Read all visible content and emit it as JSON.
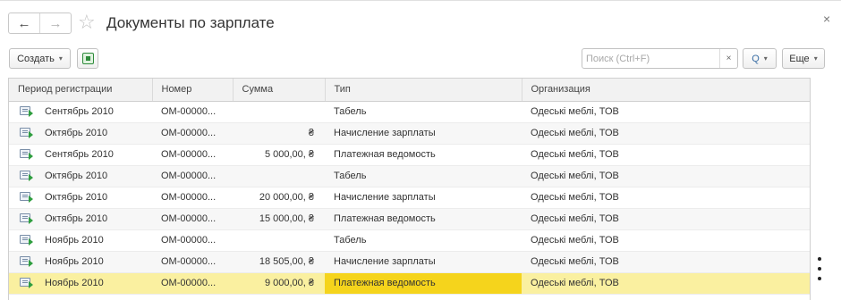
{
  "header": {
    "back_icon": "←",
    "forward_icon": "→",
    "star_icon": "☆",
    "title": "Документы по зарплате",
    "close_icon": "×"
  },
  "toolbar": {
    "create_label": "Создать",
    "caret": "▾",
    "search_placeholder": "Поиск (Ctrl+F)",
    "search_value": "",
    "clear_icon": "×",
    "search_icon": "Q",
    "more_label": "Еще"
  },
  "table": {
    "columns": [
      "Период регистрации",
      "Номер",
      "Сумма",
      "Тип",
      "Организация"
    ],
    "rows": [
      {
        "period": "Сентябрь 2010",
        "number": "ОМ-00000...",
        "sum": "",
        "type": "Табель",
        "org": "Одеські меблі, ТОВ"
      },
      {
        "period": "Октябрь 2010",
        "number": "ОМ-00000...",
        "sum": "₴",
        "type": "Начисление зарплаты",
        "org": "Одеські меблі, ТОВ"
      },
      {
        "period": "Сентябрь 2010",
        "number": "ОМ-00000...",
        "sum": "5 000,00, ₴",
        "type": "Платежная ведомость",
        "org": "Одеські меблі, ТОВ"
      },
      {
        "period": "Октябрь 2010",
        "number": "ОМ-00000...",
        "sum": "",
        "type": "Табель",
        "org": "Одеські меблі, ТОВ"
      },
      {
        "period": "Октябрь 2010",
        "number": "ОМ-00000...",
        "sum": "20 000,00, ₴",
        "type": "Начисление зарплаты",
        "org": "Одеські меблі, ТОВ"
      },
      {
        "period": "Октябрь 2010",
        "number": "ОМ-00000...",
        "sum": "15 000,00, ₴",
        "type": "Платежная ведомость",
        "org": "Одеські меблі, ТОВ"
      },
      {
        "period": "Ноябрь 2010",
        "number": "ОМ-00000...",
        "sum": "",
        "type": "Табель",
        "org": "Одеські меблі, ТОВ"
      },
      {
        "period": "Ноябрь 2010",
        "number": "ОМ-00000...",
        "sum": "18 505,00, ₴",
        "type": "Начисление зарплаты",
        "org": "Одеські меблі, ТОВ"
      },
      {
        "period": "Ноябрь 2010",
        "number": "ОМ-00000...",
        "sum": "9 000,00, ₴",
        "type": "Платежная ведомость",
        "org": "Одеські меблі, ТОВ"
      }
    ],
    "selected_row": 8,
    "selected_column": 3
  },
  "icons": {
    "row_icon": "document-arrow-icon",
    "more_menu": "kebab-menu-icon"
  },
  "colors": {
    "selected_row": "#faf0a0",
    "selected_cell": "#f5d41c",
    "alt_row": "#f7f7f7"
  }
}
